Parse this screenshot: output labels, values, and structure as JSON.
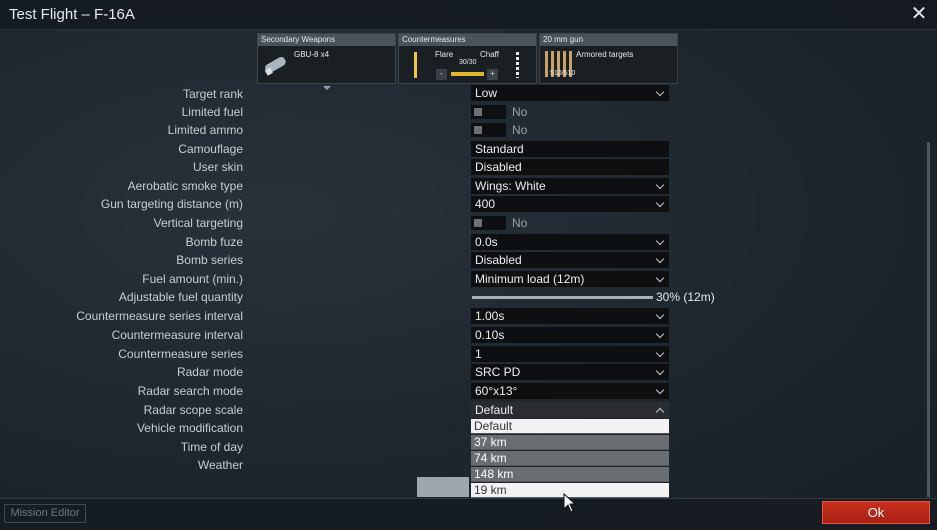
{
  "window": {
    "title": "Test Flight – F-16A"
  },
  "slots": {
    "secondary": {
      "header": "Secondary Weapons",
      "name": "GBU-8 x4"
    },
    "countermeasures": {
      "header": "Countermeasures",
      "flare": "Flare",
      "chaff": "Chaff",
      "count": "30/30",
      "minus": "-",
      "plus": "+"
    },
    "gun": {
      "header": "20 mm gun",
      "name": "Armored targets",
      "ammo": "510/510"
    }
  },
  "rows": {
    "target_rank": {
      "label": "Target rank",
      "value": "Low"
    },
    "limited_fuel": {
      "label": "Limited fuel",
      "value": "No"
    },
    "limited_ammo": {
      "label": "Limited ammo",
      "value": "No"
    },
    "camouflage": {
      "label": "Camouflage",
      "value": "Standard"
    },
    "user_skin": {
      "label": "User skin",
      "value": "Disabled"
    },
    "smoke": {
      "label": "Aerobatic smoke type",
      "value": "Wings: White"
    },
    "gun_dist": {
      "label": "Gun targeting distance (m)",
      "value": "400"
    },
    "vert": {
      "label": "Vertical targeting",
      "value": "No"
    },
    "bomb_fuze": {
      "label": "Bomb fuze",
      "value": "0.0s"
    },
    "bomb_series": {
      "label": "Bomb series",
      "value": "Disabled"
    },
    "fuel_amount": {
      "label": "Fuel amount (min.)",
      "value": "Minimum load (12m)"
    },
    "adj_fuel": {
      "label": "Adjustable fuel quantity",
      "value": "30% (12m)"
    },
    "cm_series_int": {
      "label": "Countermeasure series interval",
      "value": "1.00s"
    },
    "cm_int": {
      "label": "Countermeasure interval",
      "value": "0.10s"
    },
    "cm_series": {
      "label": "Countermeasure series",
      "value": "1"
    },
    "radar_mode": {
      "label": "Radar mode",
      "value": "SRC PD"
    },
    "radar_search": {
      "label": "Radar search mode",
      "value": "60°x13°"
    },
    "radar_scope": {
      "label": "Radar scope scale",
      "value": "Default"
    },
    "vehicle_mod": {
      "label": "Vehicle modification"
    },
    "time_of_day": {
      "label": "Time of day"
    },
    "weather": {
      "label": "Weather"
    }
  },
  "fuel_slider": {
    "fraction": 0.3
  },
  "dropdown": {
    "options": [
      "Default",
      "37 km",
      "74 km",
      "148 km",
      "19 km"
    ]
  },
  "bottom": {
    "mission_editor": "Mission Editor",
    "ok": "Ok"
  }
}
